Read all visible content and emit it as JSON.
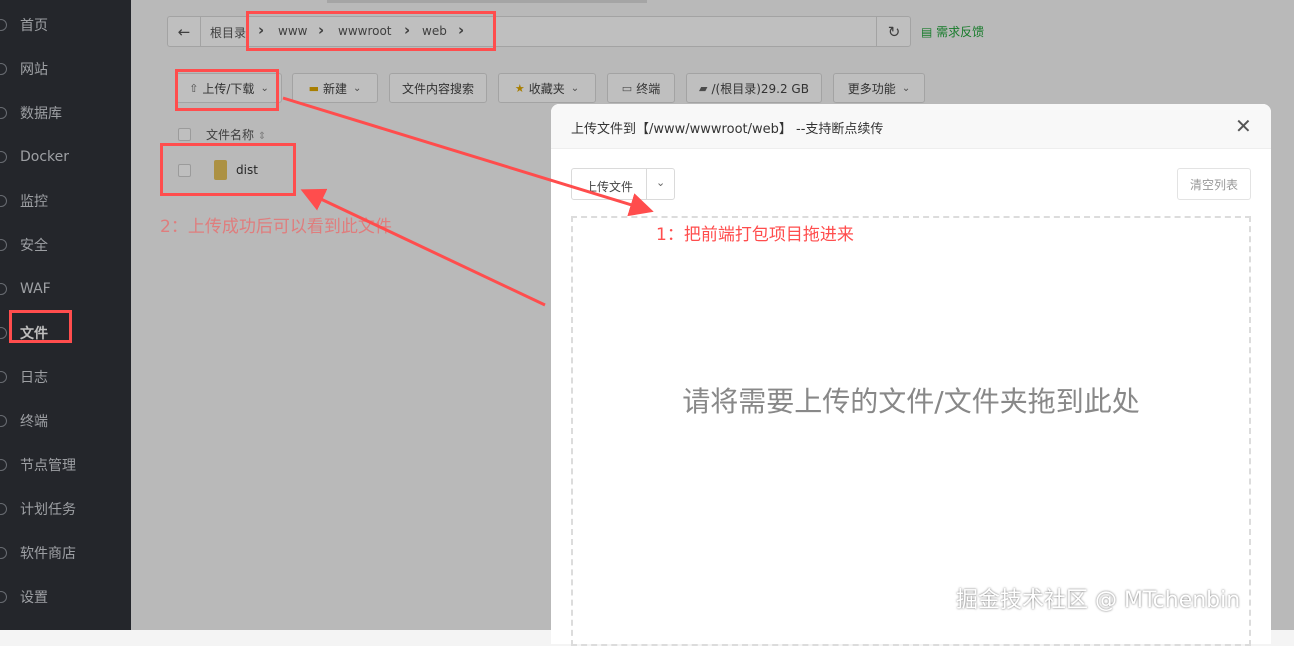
{
  "sidebar": {
    "items": [
      {
        "label": "首页"
      },
      {
        "label": "网站"
      },
      {
        "label": "数据库"
      },
      {
        "label": "Docker"
      },
      {
        "label": "监控"
      },
      {
        "label": "安全"
      },
      {
        "label": "WAF"
      },
      {
        "label": "文件"
      },
      {
        "label": "日志"
      },
      {
        "label": "终端"
      },
      {
        "label": "节点管理"
      },
      {
        "label": "计划任务"
      },
      {
        "label": "软件商店"
      },
      {
        "label": "设置"
      }
    ],
    "active": "文件"
  },
  "path": {
    "back_icon": "arrow-left-icon",
    "crumbs": [
      "根目录",
      "www",
      "wwwroot",
      "web"
    ],
    "refresh_icon": "refresh-icon",
    "feedback": "需求反馈"
  },
  "toolbar": {
    "upload": "上传/下载",
    "new": "新建",
    "content_search": "文件内容搜索",
    "favorites": "收藏夹",
    "terminal": "终端",
    "disk": "/(根目录)29.2 GB",
    "more": "更多功能"
  },
  "file_list": {
    "header": "文件名称",
    "rows": [
      {
        "name": "dist",
        "icon": "folder-icon"
      }
    ]
  },
  "dialog": {
    "title": "上传文件到【/www/wwwroot/web】 --支持断点续传",
    "upload_type": "上传文件",
    "clear": "清空列表",
    "drop_hint": "请将需要上传的文件/文件夹拖到此处"
  },
  "annotations": {
    "step1": "1：把前端打包项目拖进来",
    "step2": "2：上传成功后可以看到此文件",
    "color": "#ff4d4d"
  },
  "watermark": "掘金技术社区 @ MTchenbin"
}
